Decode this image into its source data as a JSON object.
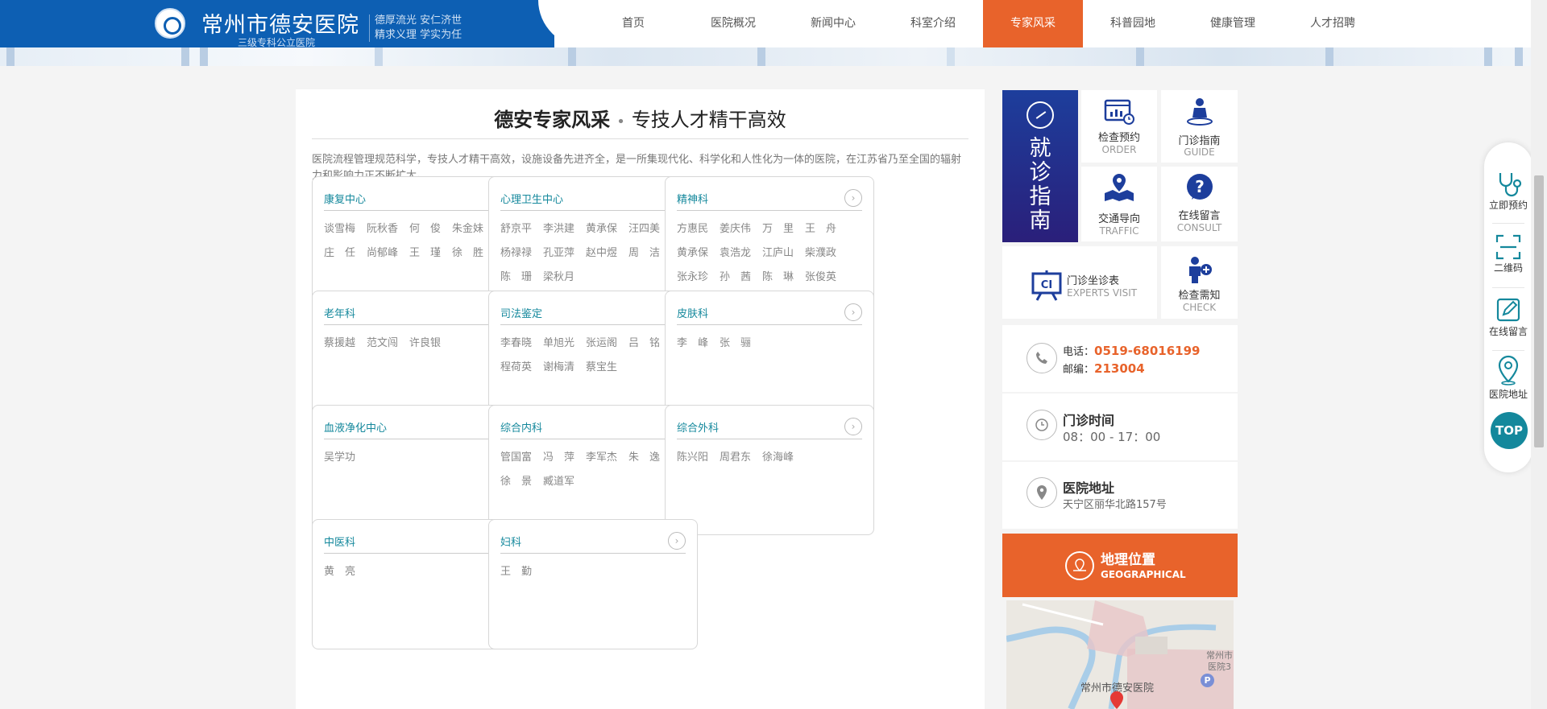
{
  "header": {
    "title": "常州市德安医院",
    "subtitle": "三级专科公立医院",
    "slogan_line1": "德厚流光 安仁济世",
    "slogan_line2": "精求义理 学实为任"
  },
  "nav": [
    "首页",
    "医院概况",
    "新闻中心",
    "科室介绍",
    "专家风采",
    "科普园地",
    "健康管理",
    "人才招聘"
  ],
  "nav_active": "专家风采",
  "main": {
    "title_bold": "德安专家风采",
    "title_sep": "•",
    "title_rest": "专技人才精干高效",
    "intro": "医院流程管理规范科学，专技人才精干高效，设施设备先进齐全，是一所集现代化、科学化和人性化为一体的医院，在江苏省乃至全国的辐射力和影响力正不断扩大。"
  },
  "arrow_glyph": "›",
  "departments": [
    {
      "name": "康复中心",
      "doctors": [
        "谈雪梅",
        "阮秋香",
        "何　俊",
        "朱金妹",
        "庄　任",
        "尚郁峰",
        "王　瑾",
        "徐　胜"
      ]
    },
    {
      "name": "心理卫生中心",
      "doctors": [
        "舒京平",
        "李洪建",
        "黄承保",
        "汪四美",
        "杨禄禄",
        "孔亚萍",
        "赵中煜",
        "周　洁",
        "陈　珊",
        "梁秋月"
      ]
    },
    {
      "name": "精神科",
      "doctors": [
        "方惠民",
        "姜庆伟",
        "万　里",
        "王　舟",
        "黄承保",
        "袁浩龙",
        "江庐山",
        "柴濮政",
        "张永珍",
        "孙　茜",
        "陈　琳",
        "张俊英"
      ]
    },
    {
      "name": "老年科",
      "doctors": [
        "蔡援越",
        "范文闯",
        "许良银"
      ]
    },
    {
      "name": "司法鉴定",
      "doctors": [
        "李春晓",
        "单旭光",
        "张运阁",
        "吕　铭",
        "程荷英",
        "谢梅清",
        "蔡宝生"
      ]
    },
    {
      "name": "皮肤科",
      "doctors": [
        "李　峰",
        "张　骊"
      ]
    },
    {
      "name": "血液净化中心",
      "doctors": [
        "吴学功"
      ]
    },
    {
      "name": "综合内科",
      "doctors": [
        "管国富",
        "冯　萍",
        "李军杰",
        "朱　逸",
        "徐　景",
        "臧道军"
      ]
    },
    {
      "name": "综合外科",
      "doctors": [
        "陈兴阳",
        "周君东",
        "徐海峰"
      ]
    },
    {
      "name": "中医科",
      "doctors": [
        "黄　亮"
      ]
    },
    {
      "name": "妇科",
      "doctors": [
        "王　勤"
      ]
    }
  ],
  "sidebar": {
    "guide_title": "就诊指南",
    "tiles": [
      {
        "label": "检查预约",
        "en": "ORDER",
        "icon": "calendar-chart-icon"
      },
      {
        "label": "门诊指南",
        "en": "GUIDE",
        "icon": "doctor-icon"
      },
      {
        "label": "交通导向",
        "en": "TRAFFIC",
        "icon": "map-pin-icon"
      },
      {
        "label": "在线留言",
        "en": "CONSULT",
        "icon": "question-icon"
      },
      {
        "label": "门诊坐诊表",
        "en": "EXPERTS VISIT",
        "icon": "schedule-board-icon"
      },
      {
        "label": "检查需知",
        "en": "CHECK",
        "icon": "patient-plus-icon"
      }
    ],
    "phone_label": "电话：",
    "phone": "0519-68016199",
    "postcode_label": "邮编：",
    "postcode": "213004",
    "hours_title": "门诊时间",
    "hours": "08：00 - 17：00",
    "address_title": "医院地址",
    "address": "天宁区丽华北路157号",
    "geo_title": "地理位置",
    "geo_en": "GEOGRAPHICAL",
    "map_label": "常州市德安医院",
    "map_label2": "常州市",
    "map_label3": "医院3",
    "map_parking": "P"
  },
  "float_tools": [
    {
      "label": "立即预约",
      "icon": "stethoscope-icon"
    },
    {
      "label": "二维码",
      "icon": "qrcode-icon"
    },
    {
      "label": "在线留言",
      "icon": "edit-icon"
    },
    {
      "label": "医院地址",
      "icon": "location-icon"
    }
  ],
  "top_label": "TOP",
  "colors": {
    "brand_blue": "#0d5fb3",
    "accent_orange": "#e8632b",
    "teal": "#14889c"
  }
}
